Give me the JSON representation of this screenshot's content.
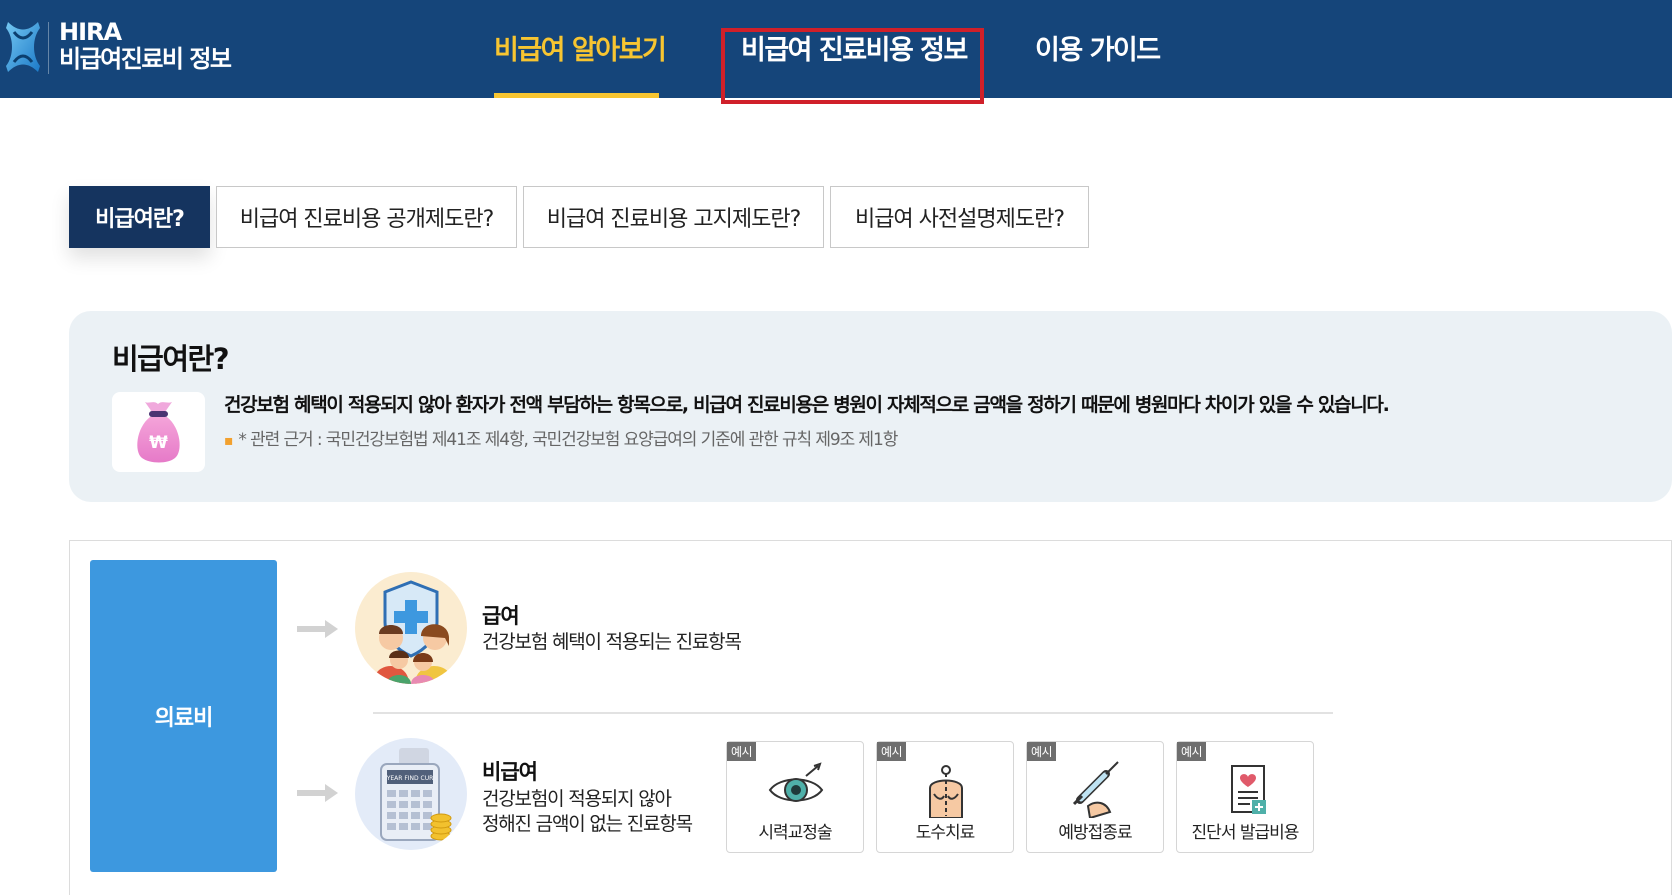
{
  "header": {
    "brand_top": "HIRA",
    "brand_bottom": "비급여진료비 정보",
    "nav": [
      {
        "label": "비급여 알아보기"
      },
      {
        "label": "비급여 진료비용 정보"
      },
      {
        "label": "이용 가이드"
      }
    ]
  },
  "subtabs": [
    {
      "label": "비급여란?"
    },
    {
      "label": "비급여 진료비용 공개제도란?"
    },
    {
      "label": "비급여 진료비용 고지제도란?"
    },
    {
      "label": "비급여 사전설명제도란?"
    }
  ],
  "info": {
    "title": "비급여란?",
    "text": "건강보험 혜택이 적용되지 않아 환자가 전액 부담하는 항목으로, 비급여 진료비용은 병원이 자체적으로 금액을 정하기 때문에 병원마다 차이가 있을 수 있습니다.",
    "note": "* 관련 근거 : 국민건강보험법 제41조 제4항, 국민건강보험 요양급여의 기준에 관한 규칙 제9조 제1항"
  },
  "diagram": {
    "root_label": "의료비",
    "covered": {
      "title": "급여",
      "desc": "건강보험 혜택이 적용되는 진료항목"
    },
    "noncovered": {
      "title": "비급여",
      "desc_line1": "건강보험이 적용되지 않아",
      "desc_line2": "정해진 금액이 없는 진료항목",
      "calculator_text": "YEAR FIND CUR"
    },
    "example_badge": "예시",
    "examples": [
      {
        "label": "시력교정술",
        "icon": "eye-icon"
      },
      {
        "label": "도수치료",
        "icon": "manual-therapy-icon"
      },
      {
        "label": "예방접종료",
        "icon": "syringe-icon"
      },
      {
        "label": "진단서 발급비용",
        "icon": "certificate-icon"
      }
    ]
  },
  "colors": {
    "header_bg": "#15457a",
    "active_nav": "#f7c531",
    "highlight_box": "#d0202a",
    "active_tab": "#15345f",
    "root_box": "#3d98df",
    "info_bg": "#ebf1f5"
  }
}
